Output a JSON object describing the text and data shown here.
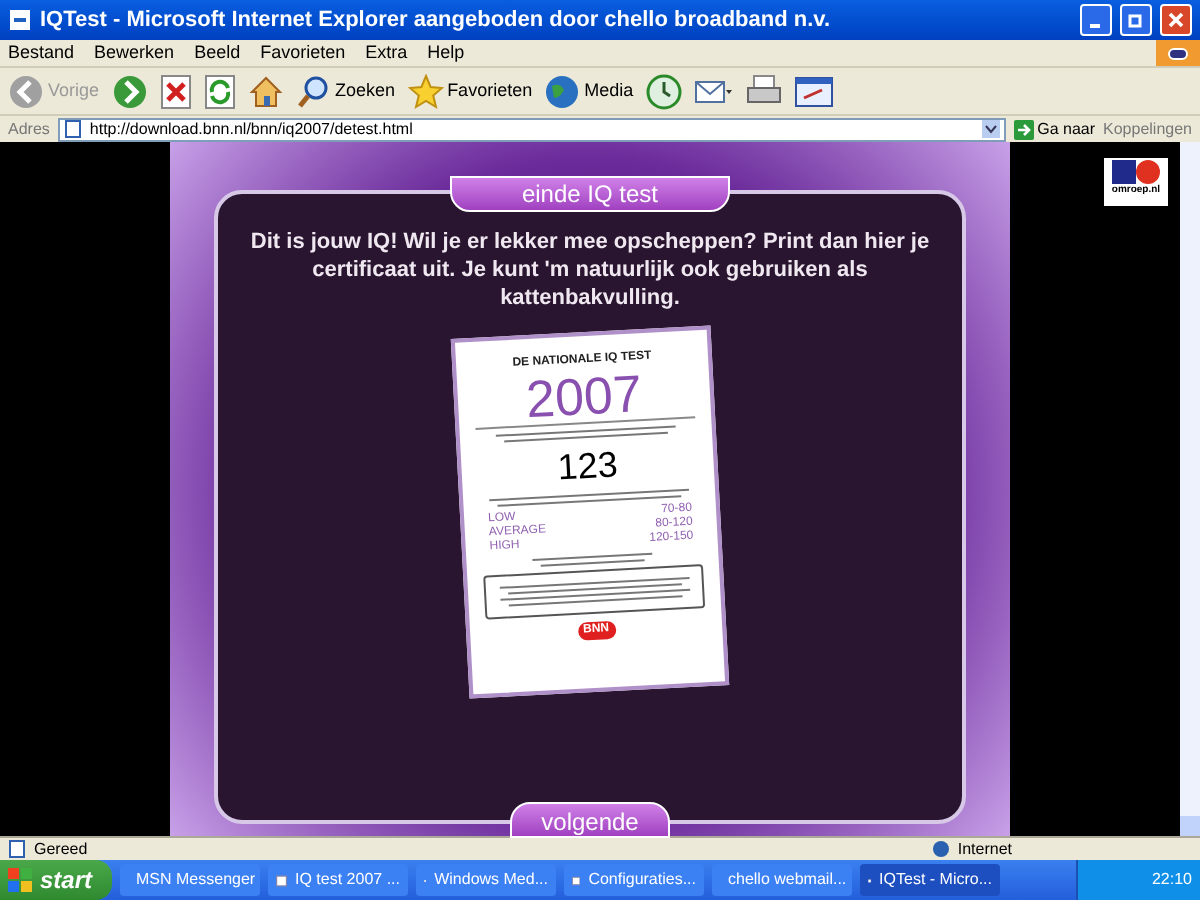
{
  "window": {
    "title": "IQTest - Microsoft Internet Explorer aangeboden door chello broadband n.v."
  },
  "menu": [
    "Bestand",
    "Bewerken",
    "Beeld",
    "Favorieten",
    "Extra",
    "Help"
  ],
  "toolbar": [
    {
      "kind": "back",
      "label": "Vorige",
      "disabled": true
    },
    {
      "kind": "forward",
      "disabled": false
    },
    {
      "kind": "stop"
    },
    {
      "kind": "refresh"
    },
    {
      "kind": "home"
    },
    {
      "kind": "search",
      "label": "Zoeken"
    },
    {
      "kind": "favorites",
      "label": "Favorieten"
    },
    {
      "kind": "media",
      "label": "Media"
    },
    {
      "kind": "history"
    },
    {
      "kind": "mail"
    },
    {
      "kind": "print"
    },
    {
      "kind": "edit"
    }
  ],
  "address": {
    "label": "Adres",
    "value": "http://download.bnn.nl/bnn/iq2007/detest.html",
    "go": "Ga naar",
    "links": "Koppelingen"
  },
  "page": {
    "logo": "omroep.nl",
    "header": "einde IQ test",
    "message": "Dit is jouw IQ! Wil je er lekker mee opscheppen? Print dan hier je certificaat uit. Je kunt 'm natuurlijk ook gebruiken als kattenbakvulling.",
    "certificate": {
      "brand": "DE NATIONALE IQ TEST",
      "year": "2007",
      "score": "123",
      "ranges": [
        {
          "label": "LOW",
          "range": "70-80"
        },
        {
          "label": "AVERAGE",
          "range": "80-120"
        },
        {
          "label": "HIGH",
          "range": "120-150"
        }
      ],
      "badge": "BNN"
    },
    "next": "volgende"
  },
  "status_bar": {
    "text": "Gereed",
    "zone": "Internet"
  },
  "taskbar": {
    "start": "start",
    "items": [
      {
        "label": "MSN Messenger",
        "selected": false
      },
      {
        "label": "IQ test 2007 ...",
        "selected": false
      },
      {
        "label": "Windows Med...",
        "selected": false
      },
      {
        "label": "Configuraties...",
        "selected": false
      },
      {
        "label": "chello webmail...",
        "selected": false
      },
      {
        "label": "IQTest - Micro...",
        "selected": true
      }
    ],
    "clock": "22:10"
  }
}
